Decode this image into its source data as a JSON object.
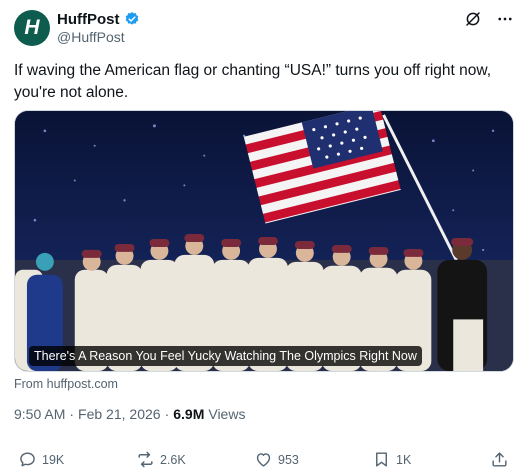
{
  "author": {
    "avatar_letter": "H",
    "display_name": "HuffPost",
    "handle": "@HuffPost"
  },
  "tweet": {
    "text": "If waving the American flag or chanting “USA!” turns you off right now, you're not alone."
  },
  "card": {
    "headline": "There's A Reason You Feel Yucky Watching The Olympics Right Now",
    "source": "From huffpost.com"
  },
  "meta": {
    "time": "9:50 AM",
    "separator": "·",
    "date": "Feb 21, 2026",
    "views": "6.9M",
    "views_label": "Views"
  },
  "actions": {
    "replies": "19K",
    "reposts": "2.6K",
    "likes": "953",
    "bookmarks": "1K"
  },
  "colors": {
    "brand_avatar": "#0d5c4d",
    "verified": "#1d9bf0",
    "muted_text": "#536471"
  },
  "icons": [
    "verified-badge-icon",
    "grok-icon",
    "more-icon",
    "reply-icon",
    "repost-icon",
    "like-icon",
    "bookmark-icon",
    "share-icon"
  ]
}
